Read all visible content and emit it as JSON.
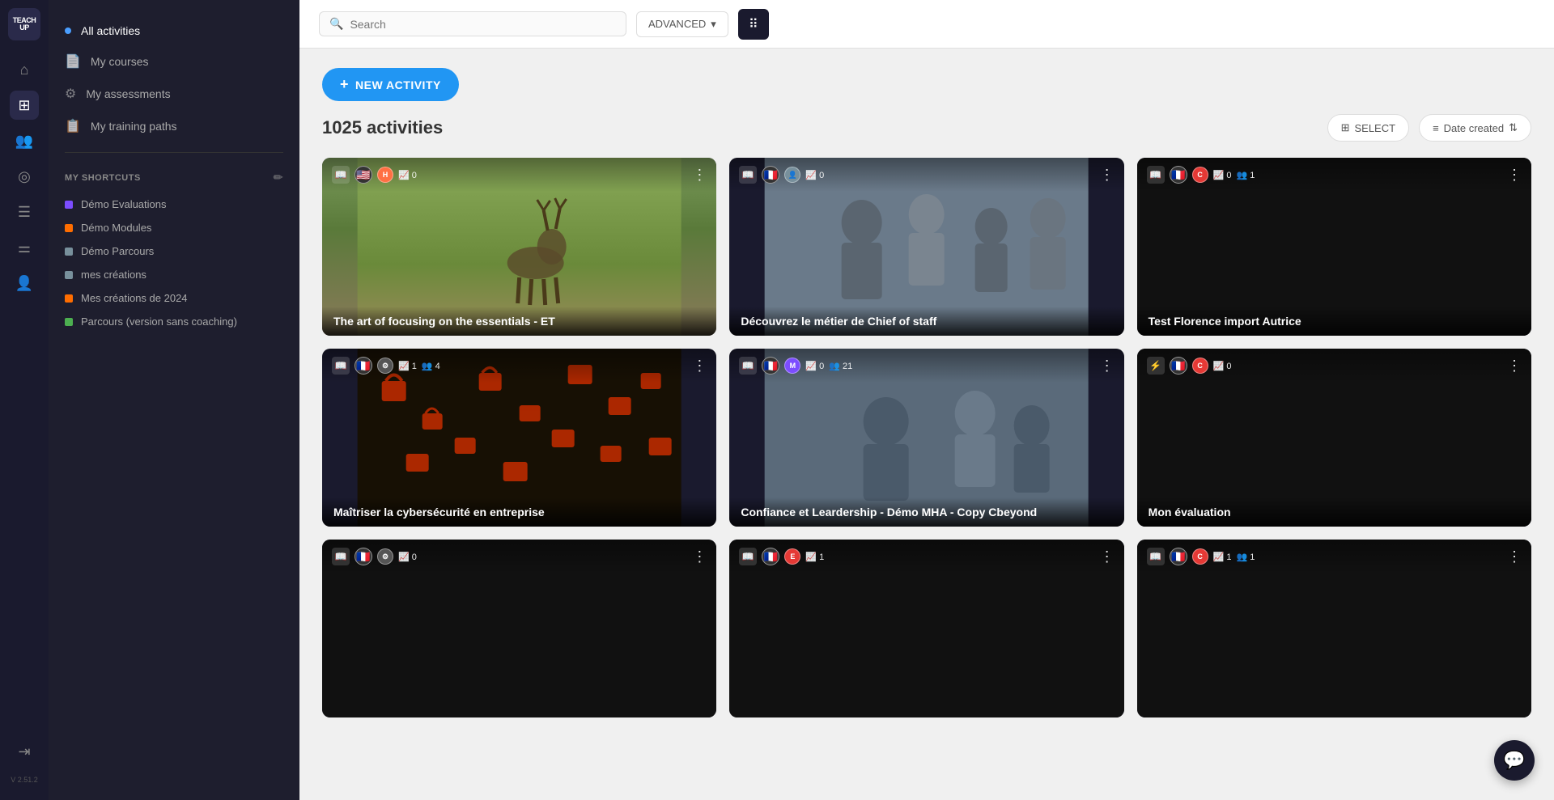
{
  "app": {
    "version": "V 2.51.2",
    "logo_line1": "TEACH",
    "logo_line2": "UP"
  },
  "topbar": {
    "search_placeholder": "Search",
    "advanced_label": "ADVANCED",
    "new_activity_label": "NEW ACTIVITY"
  },
  "sidebar": {
    "nav_items": [
      {
        "id": "all-activities",
        "label": "All activities",
        "active": true,
        "has_dot": true
      },
      {
        "id": "my-courses",
        "label": "My courses",
        "active": false
      },
      {
        "id": "my-assessments",
        "label": "My assessments",
        "active": false
      },
      {
        "id": "my-training-paths",
        "label": "My training paths",
        "active": false
      }
    ],
    "shortcuts_header": "MY SHORTCUTS",
    "shortcuts": [
      {
        "id": "demo-evaluations",
        "label": "Démo Evaluations",
        "color": "#7c4dff"
      },
      {
        "id": "demo-modules",
        "label": "Démo Modules",
        "color": "#ff6d00"
      },
      {
        "id": "demo-parcours",
        "label": "Démo Parcours",
        "color": "#78909c"
      },
      {
        "id": "mes-creations",
        "label": "mes créations",
        "color": "#78909c"
      },
      {
        "id": "mes-creations-2024",
        "label": "Mes créations de 2024",
        "color": "#ff6d00"
      },
      {
        "id": "parcours-sans-coaching",
        "label": "Parcours (version sans coaching)",
        "color": "#4caf50"
      }
    ]
  },
  "content": {
    "activities_count": "1025 activities",
    "select_label": "SELECT",
    "date_created_label": "Date created",
    "cards": [
      {
        "id": "card-1",
        "title": "The art of focusing on the essentials - ET",
        "type": "book",
        "flag": "🇺🇸",
        "extra_icon": "h",
        "extra_icon_color": "#ff7043",
        "stat": "0",
        "users_count": null,
        "bg_type": "deer"
      },
      {
        "id": "card-2",
        "title": "Découvrez le métier de Chief of staff",
        "type": "book",
        "flag": "🇫🇷",
        "extra_icon": "👤",
        "extra_icon_color": "#78909c",
        "stat": "0",
        "users_count": null,
        "bg_type": "meeting"
      },
      {
        "id": "card-3",
        "title": "Test Florence import Autrice",
        "type": "book",
        "flag": "🇫🇷",
        "extra_icon": "C",
        "extra_icon_color": "#e53935",
        "stat": "0",
        "users_count": "1",
        "bg_type": "dark"
      },
      {
        "id": "card-4",
        "title": "Maîtriser la cybersécurité en entreprise",
        "type": "book",
        "flag": "🇫🇷",
        "extra_icon": "⚙",
        "extra_icon_color": "#555",
        "stat": "1",
        "users_count": "4",
        "bg_type": "cyber"
      },
      {
        "id": "card-5",
        "title": "Confiance et Leardership - Démo MHA - Copy Cbeyond",
        "type": "book",
        "flag": "🇫🇷",
        "extra_icon": "M",
        "extra_icon_color": "#7c4dff",
        "stat": "0",
        "users_count": "21",
        "bg_type": "meeting2"
      },
      {
        "id": "card-6",
        "title": "Mon évaluation",
        "type": "speed",
        "flag": "🇫🇷",
        "extra_icon": "C",
        "extra_icon_color": "#e53935",
        "stat": "0",
        "users_count": null,
        "bg_type": "dark"
      },
      {
        "id": "card-7",
        "title": "",
        "type": "book",
        "flag": "🇫🇷",
        "extra_icon": "⚙",
        "extra_icon_color": "#555",
        "stat": "0",
        "users_count": null,
        "bg_type": "dark"
      },
      {
        "id": "card-8",
        "title": "",
        "type": "book",
        "flag": "🇫🇷",
        "extra_icon": "E",
        "extra_icon_color": "#e53935",
        "stat": "1",
        "users_count": null,
        "bg_type": "dark"
      },
      {
        "id": "card-9",
        "title": "",
        "type": "book",
        "flag": "🇫🇷",
        "extra_icon": "C",
        "extra_icon_color": "#e53935",
        "stat": "1",
        "users_count": "1",
        "bg_type": "dark"
      }
    ]
  }
}
